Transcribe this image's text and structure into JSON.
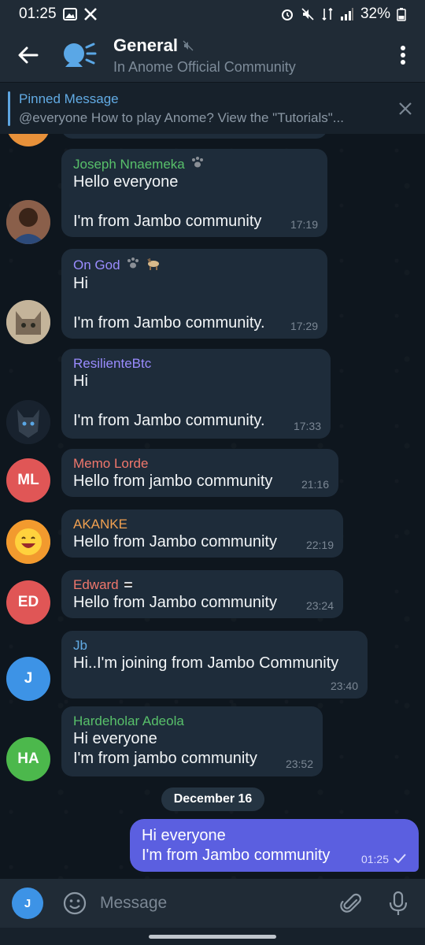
{
  "status_bar": {
    "time": "01:25",
    "battery": "32%"
  },
  "header": {
    "title": "General",
    "subtitle": "In Anome Official Community"
  },
  "pinned": {
    "title": "Pinned Message",
    "text": "@everyone  How to play Anome? View the \"Tutorials\"..."
  },
  "messages": [
    {
      "sender": "Joseph Nnaemeka",
      "sender_color": "#58c06a",
      "lines": [
        "Hello everyone",
        "",
        "I'm from Jambo community"
      ],
      "time": "17:19"
    },
    {
      "sender": "On God",
      "sender_color": "#9a8cff",
      "lines": [
        "Hi",
        "",
        "I'm from Jambo community."
      ],
      "time": "17:29"
    },
    {
      "sender": "ResilienteBtc",
      "sender_color": "#9a8cff",
      "lines": [
        "Hi",
        "",
        "I'm from Jambo community."
      ],
      "time": "17:33"
    },
    {
      "sender": "Memo Lorde",
      "sender_color": "#f0776c",
      "lines": [
        "Hello from jambo community"
      ],
      "time": "21:16",
      "initials": "ML",
      "avatar_color": "#e05656"
    },
    {
      "sender": "AKANKE",
      "sender_color": "#f0a050",
      "lines": [
        "Hello from Jambo community"
      ],
      "time": "22:19"
    },
    {
      "sender": "Edward",
      "sender_color": "#f0776c",
      "lines": [
        "Hello from Jambo community"
      ],
      "time": "23:24",
      "initials": "ED",
      "avatar_color": "#e05656"
    },
    {
      "sender": "Jb",
      "sender_color": "#62abe4",
      "lines": [
        "Hi..I'm joining from Jambo Community"
      ],
      "time": "23:40",
      "initials": "J",
      "avatar_color": "#3d93e6"
    },
    {
      "sender": "Hardeholar Adeola",
      "sender_color": "#58c06a",
      "lines": [
        "Hi everyone",
        "I'm from jambo community"
      ],
      "time": "23:52",
      "initials": "HA",
      "avatar_color": "#4cb84c"
    }
  ],
  "date_separator": "December 16",
  "outgoing": {
    "lines": [
      "Hi everyone",
      "I'm from Jambo community"
    ],
    "time": "01:25"
  },
  "composer": {
    "avatar_initial": "J",
    "placeholder": "Message"
  }
}
